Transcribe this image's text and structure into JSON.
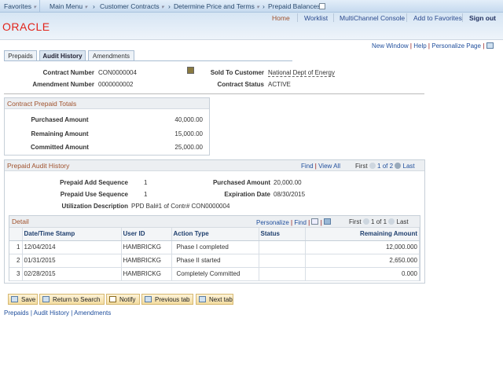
{
  "topnav": {
    "favorites": "Favorites",
    "main_menu": "Main Menu",
    "breadcrumb": [
      "Customer Contracts",
      "Determine Price and Terms",
      "Prepaid Balances"
    ]
  },
  "header": {
    "links": [
      "Home",
      "Worklist",
      "MultiChannel Console",
      "Add to Favorites"
    ],
    "sign_out": "Sign out",
    "logo": "ORACLE"
  },
  "pagelinks": {
    "new_window": "New Window",
    "help": "Help",
    "personalize": "Personalize Page"
  },
  "tabs": [
    {
      "label": "Prepaids",
      "active": false
    },
    {
      "label": "Audit History",
      "active": true
    },
    {
      "label": "Amendments",
      "active": false
    }
  ],
  "contract": {
    "contract_number_label": "Contract Number",
    "contract_number": "CON0000004",
    "amendment_label": "Amendment Number",
    "amendment": "0000000002",
    "sold_to_label": "Sold To Customer",
    "sold_to": "National Dept of Energy",
    "status_label": "Contract Status",
    "status": "ACTIVE"
  },
  "totals": {
    "title": "Contract Prepaid Totals",
    "rows": [
      {
        "label": "Purchased Amount",
        "value": "40,000.00"
      },
      {
        "label": "Remaining Amount",
        "value": "15,000.00"
      },
      {
        "label": "Committed Amount",
        "value": "25,000.00"
      }
    ]
  },
  "audit": {
    "title": "Prepaid Audit History",
    "find": "Find",
    "view_all": "View All",
    "first": "First",
    "page": "1 of 2",
    "last": "Last",
    "add_seq_label": "Prepaid Add Sequence",
    "add_seq": "1",
    "use_seq_label": "Prepaid Use Sequence",
    "use_seq": "1",
    "purchased_label": "Purchased Amount",
    "purchased": "20,000.00",
    "expiration_label": "Expiration Date",
    "expiration": "08/30/2015",
    "util_label": "Utilization Description",
    "util": "PPD Bal#1 of Contr# CON0000004"
  },
  "detail": {
    "title": "Detail",
    "personalize": "Personalize",
    "find": "Find",
    "first": "First",
    "page": "1 of 1",
    "last": "Last",
    "columns": [
      "Date/Time Stamp",
      "User ID",
      "Action Type",
      "Status",
      "Remaining Amount"
    ],
    "rows": [
      {
        "n": "1",
        "date": "12/04/2014",
        "user": "HAMBRICKG",
        "action": "Phase I completed",
        "status": "",
        "remaining": "12,000.000"
      },
      {
        "n": "2",
        "date": "01/31/2015",
        "user": "HAMBRICKG",
        "action": "Phase II started",
        "status": "",
        "remaining": "2,650.000"
      },
      {
        "n": "3",
        "date": "02/28/2015",
        "user": "HAMBRICKG",
        "action": "Completely Committed",
        "status": "",
        "remaining": "0.000"
      }
    ]
  },
  "buttons": {
    "save": "Save",
    "return": "Return to Search",
    "notify": "Notify",
    "prev": "Previous tab",
    "next": "Next tab"
  },
  "footer": [
    "Prepaids",
    "Audit History",
    "Amendments"
  ]
}
